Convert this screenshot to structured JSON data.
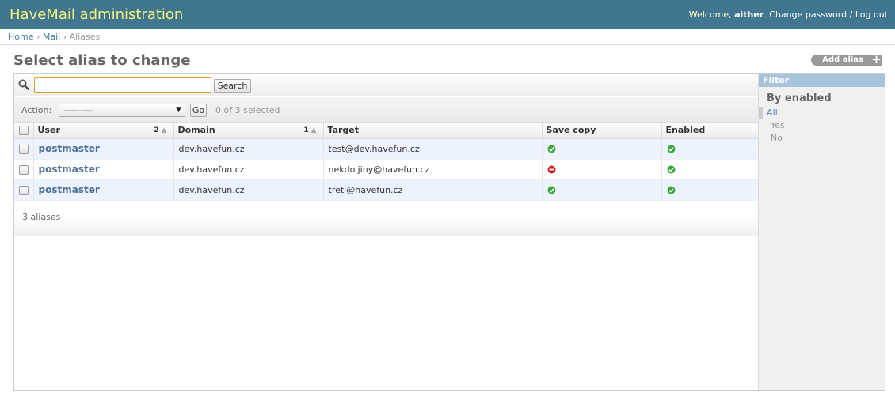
{
  "header": {
    "site_name": "HaveMail administration",
    "welcome": "Welcome,",
    "username": "aither",
    "change_password": "Change password",
    "separator": "/",
    "logout": "Log out"
  },
  "breadcrumbs": {
    "home": "Home",
    "app": "Mail",
    "current": "Aliases",
    "separator": "›"
  },
  "page": {
    "title": "Select alias to change",
    "add_button": "Add alias",
    "add_icon": "+"
  },
  "search": {
    "value": "",
    "placeholder": "",
    "button": "Search"
  },
  "actions": {
    "label": "Action:",
    "selected_value": "---------",
    "go": "Go",
    "selected_count": "0 of 3 selected"
  },
  "table": {
    "columns": {
      "user": "User",
      "user_sort_priority": "2",
      "domain": "Domain",
      "domain_sort_priority": "1",
      "target": "Target",
      "save_copy": "Save copy",
      "enabled": "Enabled"
    },
    "rows": [
      {
        "user": "postmaster",
        "domain": "dev.havefun.cz",
        "target": "test@dev.havefun.cz",
        "save_copy": true,
        "enabled": true
      },
      {
        "user": "postmaster",
        "domain": "dev.havefun.cz",
        "target": "nekdo.jiny@havefun.cz",
        "save_copy": false,
        "enabled": true
      },
      {
        "user": "postmaster",
        "domain": "dev.havefun.cz",
        "target": "treti@havefun.cz",
        "save_copy": true,
        "enabled": true
      }
    ],
    "icons": {
      "yes": "yes-icon",
      "no": "no-icon"
    },
    "colors": {
      "yes": "#3aa83a",
      "no": "#cc2222"
    }
  },
  "paginator": {
    "text": "3 aliases"
  },
  "filter": {
    "title": "Filter",
    "heading": "By enabled",
    "options": [
      "All",
      "Yes",
      "No"
    ],
    "selected": "All"
  },
  "colors": {
    "header_bg": "#417690",
    "brand_text": "#f4f379",
    "link": "#447e9b",
    "row_alt": "#edf3fe",
    "filter_title_bg": "#a8c4dd"
  }
}
